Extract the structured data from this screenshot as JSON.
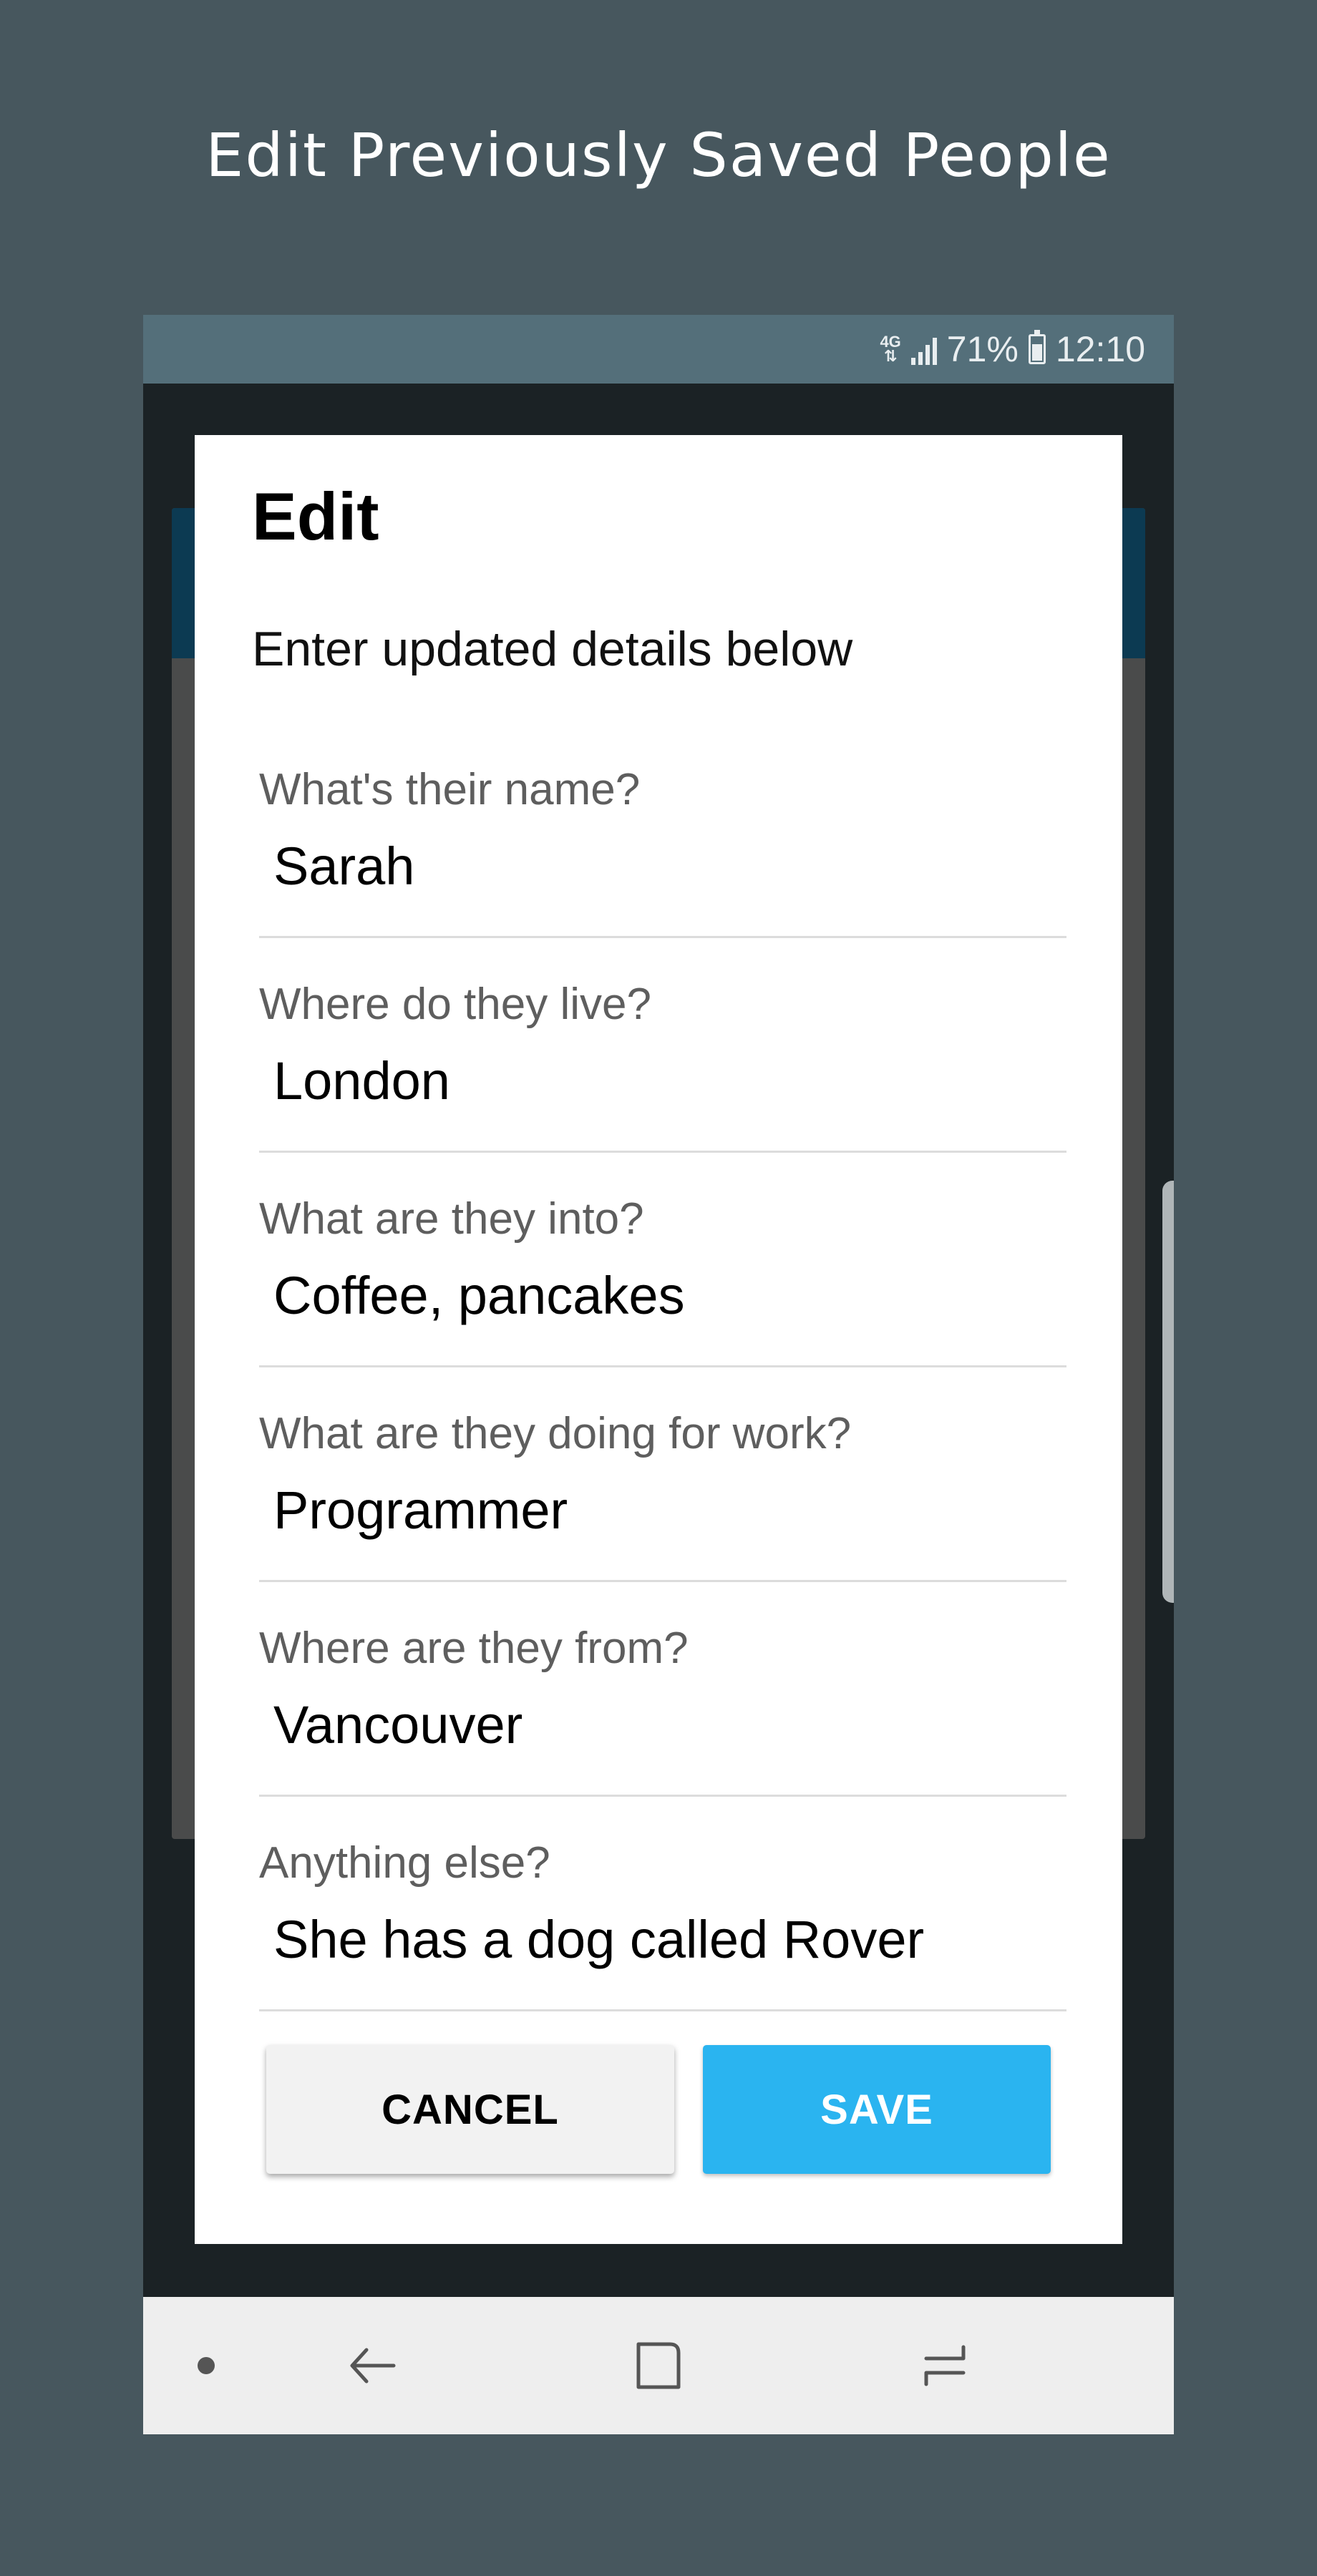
{
  "headline": "Edit Previously Saved People",
  "status_bar": {
    "network": "4G",
    "battery": "71%",
    "time": "12:10"
  },
  "dialog": {
    "title": "Edit",
    "subtitle": "Enter updated details below",
    "fields": [
      {
        "label": "What's their name?",
        "value": "Sarah"
      },
      {
        "label": "Where do they live?",
        "value": "London"
      },
      {
        "label": "What are they into?",
        "value": "Coffee, pancakes"
      },
      {
        "label": "What are they doing for work?",
        "value": "Programmer"
      },
      {
        "label": "Where are they from?",
        "value": "Vancouver"
      },
      {
        "label": "Anything else?",
        "value": "She has a dog called Rover"
      }
    ],
    "cancel_label": "CANCEL",
    "save_label": "SAVE"
  },
  "colors": {
    "background": "#47575e",
    "status_bar": "#546f7a",
    "save_button": "#2ab4f0",
    "cancel_button": "#f2f2f2"
  },
  "nav_bar": {
    "icons": [
      "menu-dot-icon",
      "back-icon",
      "home-icon",
      "recents-icon"
    ]
  }
}
